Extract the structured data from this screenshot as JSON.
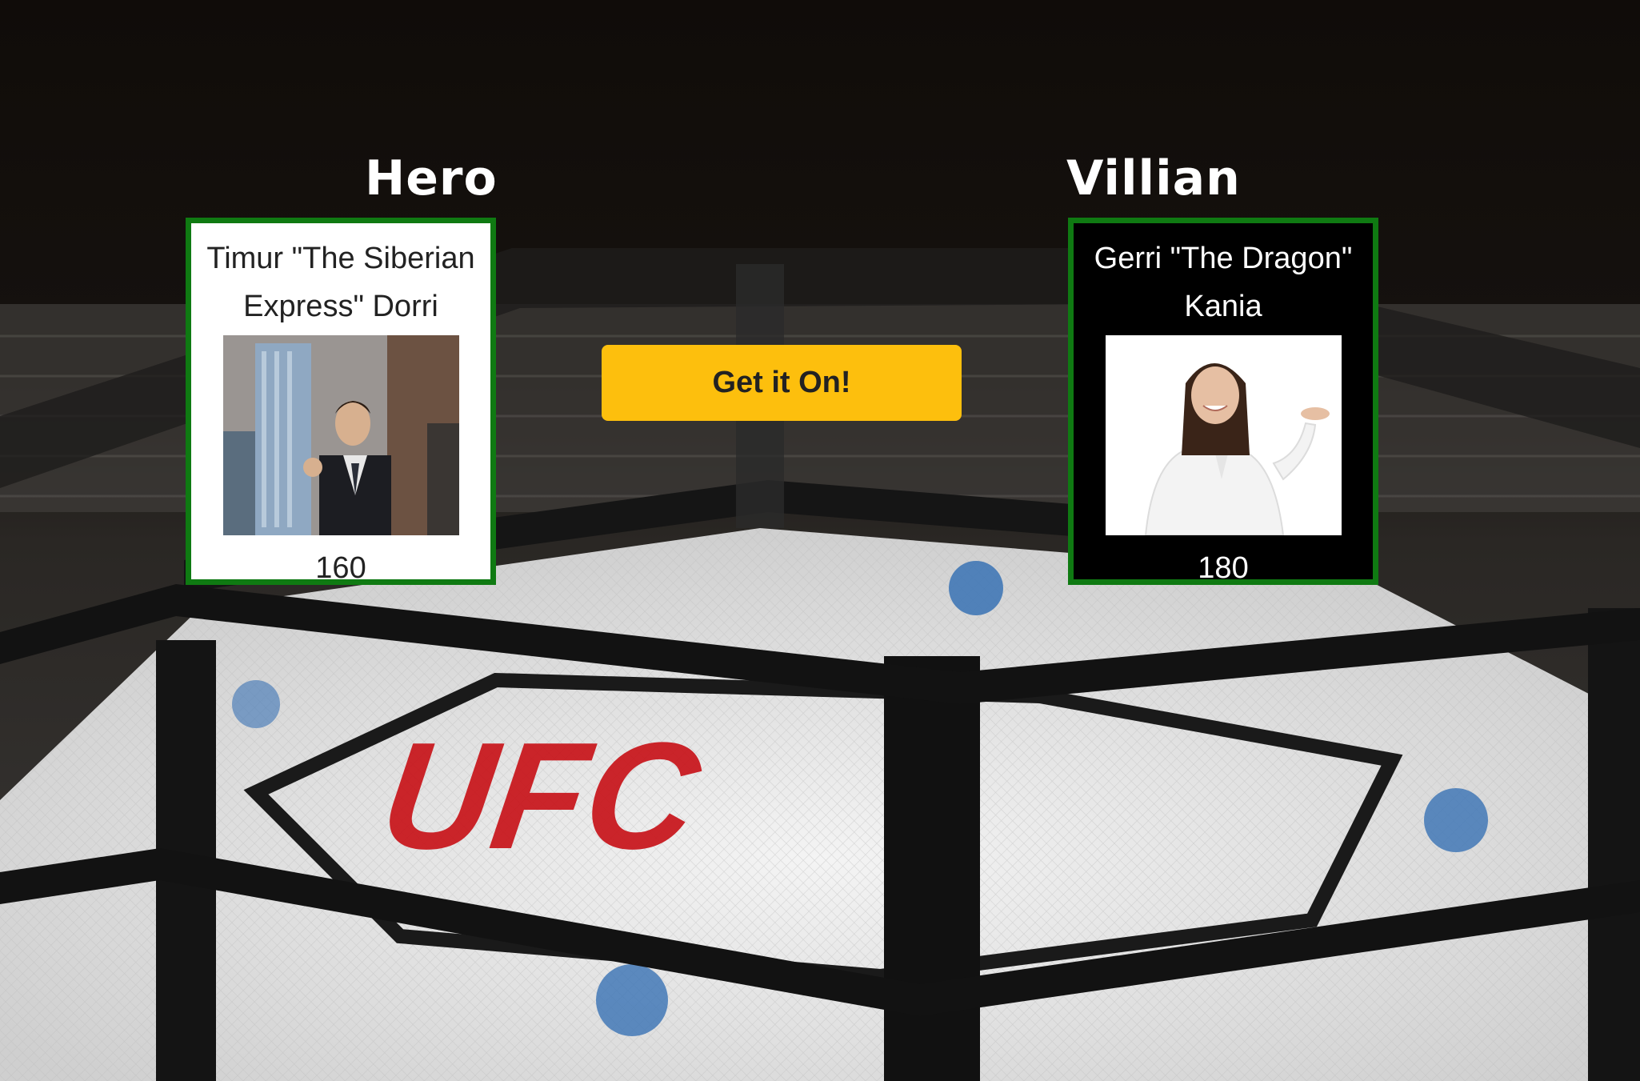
{
  "hero": {
    "heading": "Hero",
    "name": "Timur \"The Siberian Express\" Dorri",
    "score": "160",
    "photo_icon": "man-in-suit-photo"
  },
  "villain": {
    "heading": "Villian",
    "name": "Gerri \"The Dragon\" Kania",
    "score": "180",
    "photo_icon": "woman-in-white-suit-photo"
  },
  "fight_button": {
    "label": "Get it On!"
  },
  "colors": {
    "button": "#fdbf0d",
    "card_border": "#0f7a12",
    "background": "#0e0b09"
  },
  "arena": {
    "logo_text": "UFC"
  }
}
